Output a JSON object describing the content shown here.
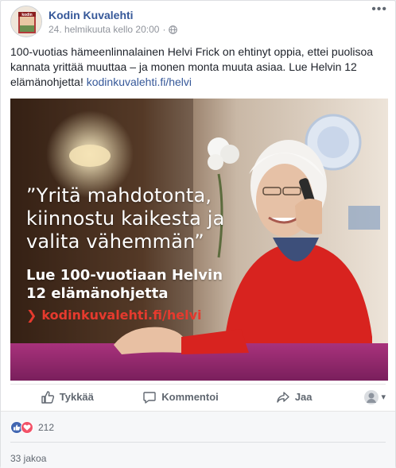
{
  "post": {
    "page_name": "Kodin Kuvalehti",
    "timestamp": "24. helmikuuta kello 20:00",
    "dot": "·",
    "text": "100-vuotias hämeenlinnalainen Helvi Frick on ehtinyt oppia, ettei puolisoa kannata yrittää muuttaa – ja monen monta muuta asiaa. Lue Helvin 12 elämänohjetta!",
    "link_text": "kodinkuvalehti.fi/helvi",
    "more_label": "•••",
    "avatar_label": "kodin"
  },
  "image": {
    "quote_line1": "”Yritä mahdotonta,",
    "quote_line2": "kiinnostu kaikesta ja",
    "quote_line3": "valita vähemmän”",
    "sub_line1": "Lue 100-vuotiaan Helvin",
    "sub_line2": "12 elämänohjetta",
    "url": "kodinkuvalehti.fi/helvi",
    "chevron": "❯"
  },
  "actions": {
    "like": "Tykkää",
    "comment": "Kommentoi",
    "share": "Jaa",
    "caret": "▾"
  },
  "footer": {
    "reaction_count": "212",
    "shares": "33 jakoa"
  },
  "colors": {
    "link": "#365899",
    "like_blue": "#4267b2",
    "love_red": "#f25268",
    "image_link_red": "#e63a2e"
  },
  "icons": [
    "globe-icon",
    "more-icon",
    "like-icon",
    "comment-icon",
    "share-icon",
    "love-icon"
  ]
}
